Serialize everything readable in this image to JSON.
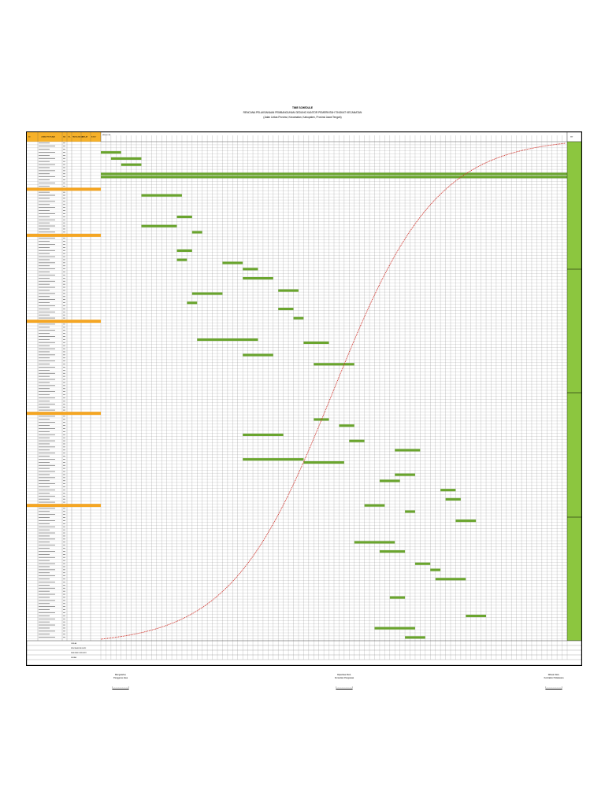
{
  "document": {
    "title_line1": "TIME SCHEDULE",
    "title_line2": "RENCANA PELAKSANAAN PEMBANGUNAN GEDUNG KANTOR PEMERINTAH TINGKAT KECAMATAN",
    "title_line3": "(Jalan Lintas Provinsi, Kecamatan, Kabupaten, Provinsi Jawa Tengah)"
  },
  "table": {
    "headers": [
      "NO",
      "URAIAN PEKERJAAN",
      "SAT",
      "VOL",
      "HARGA SATUAN",
      "JUMLAH",
      "BOBOT",
      "MINGGU KE"
    ],
    "right_header": "KET",
    "footer_labels": [
      "JUMLAH",
      "RENCANA KUMULATIF",
      "REALISASI KUMULATIF",
      "DEVIASI"
    ]
  },
  "colors": {
    "bar": "#6aa52e",
    "section": "#f5a623",
    "curve": "#d0342c",
    "side_panel": "#8cc63f",
    "grid_line": "#8a8a8a"
  },
  "signatures": [
    {
      "role": "Mengetahui,",
      "title": "Pengguna Jasa",
      "name": "(...........................)"
    },
    {
      "role": "Diperiksa Oleh,",
      "title": "Konsultan Pengawas",
      "name": "(...........................)"
    },
    {
      "role": "Dibuat Oleh,",
      "title": "Kontraktor Pelaksana",
      "name": "(...........................)"
    }
  ]
}
